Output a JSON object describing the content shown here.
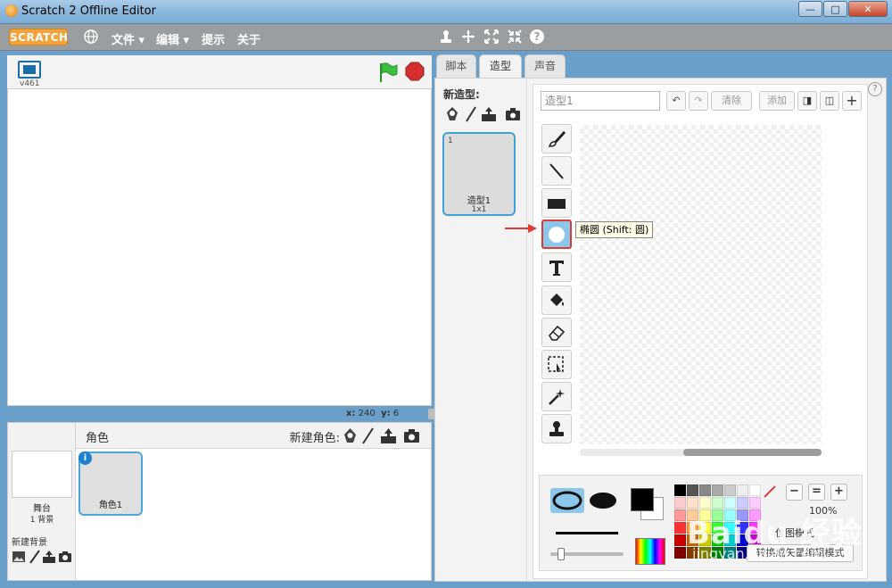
{
  "window": {
    "title": "Scratch 2 Offline Editor"
  },
  "menubar": {
    "logo": "SCRATCH",
    "items": [
      "文件",
      "编辑",
      "提示",
      "关于"
    ]
  },
  "stage": {
    "version": "v461",
    "coords": {
      "x_label": "x:",
      "x": "240",
      "y_label": "y:",
      "y": "6"
    }
  },
  "sprites_panel": {
    "title": "角色",
    "new_sprite_label": "新建角色:",
    "stage_label": "舞台",
    "backdrop_count": "1 背景",
    "new_backdrop_label": "新建背景",
    "sprite_name": "角色1"
  },
  "tabs": [
    "脚本",
    "造型",
    "声音"
  ],
  "costumes": {
    "new_label": "新造型:",
    "item": {
      "index": "1",
      "name": "造型1",
      "size": "1x1"
    }
  },
  "editor": {
    "name_value": "造型1",
    "clear_label": "清除",
    "add_label": "添加",
    "tooltip": "椭圆 (Shift: 圆)",
    "selected_tool": "ellipse-tool",
    "zoom": "100%",
    "mode_text": "位图模式",
    "convert_label": "转换成矢量编辑模式",
    "fill_color": "#000000"
  },
  "palette_colors": [
    "#000000",
    "#555555",
    "#888888",
    "#aaaaaa",
    "#cccccc",
    "#eeeeee",
    "#ffffff",
    "#ffcccc",
    "#ffe0cc",
    "#ffffcc",
    "#ccffcc",
    "#ccffff",
    "#ccccff",
    "#ffccff",
    "#ff9999",
    "#ffcc99",
    "#ffff99",
    "#99ff99",
    "#99ffff",
    "#9999ff",
    "#ff99ff",
    "#ff3333",
    "#ff9933",
    "#ffff33",
    "#33ff33",
    "#33ffff",
    "#3333ff",
    "#ff33ff",
    "#cc0000",
    "#cc6600",
    "#cccc00",
    "#00cc00",
    "#00cccc",
    "#0000cc",
    "#cc00cc",
    "#800000",
    "#804000",
    "#808000",
    "#008000",
    "#008080",
    "#000080",
    "#800080"
  ],
  "watermark": {
    "line1": "Baidu 经验",
    "line2": "jingyan.baidu.com"
  }
}
